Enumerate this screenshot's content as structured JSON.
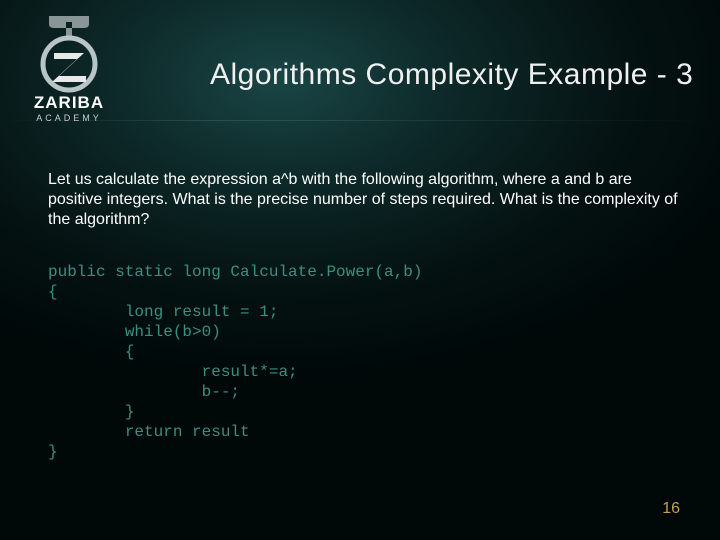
{
  "logo": {
    "brand_top": "ZARIBA",
    "brand_bottom": "ACADEMY"
  },
  "title": "Algorithms Complexity Example - 3",
  "paragraph": "Let us calculate the expression a^b with the following algorithm, where a and b are positive integers. What is the precise number of steps required. What is the complexity of the algorithm?",
  "code": "public static long Calculate.Power(a,b)\n{\n        long result = 1;\n        while(b>0)\n        {\n                result*=a;\n                b--;\n        }\n        return result\n}",
  "page_number": "16"
}
